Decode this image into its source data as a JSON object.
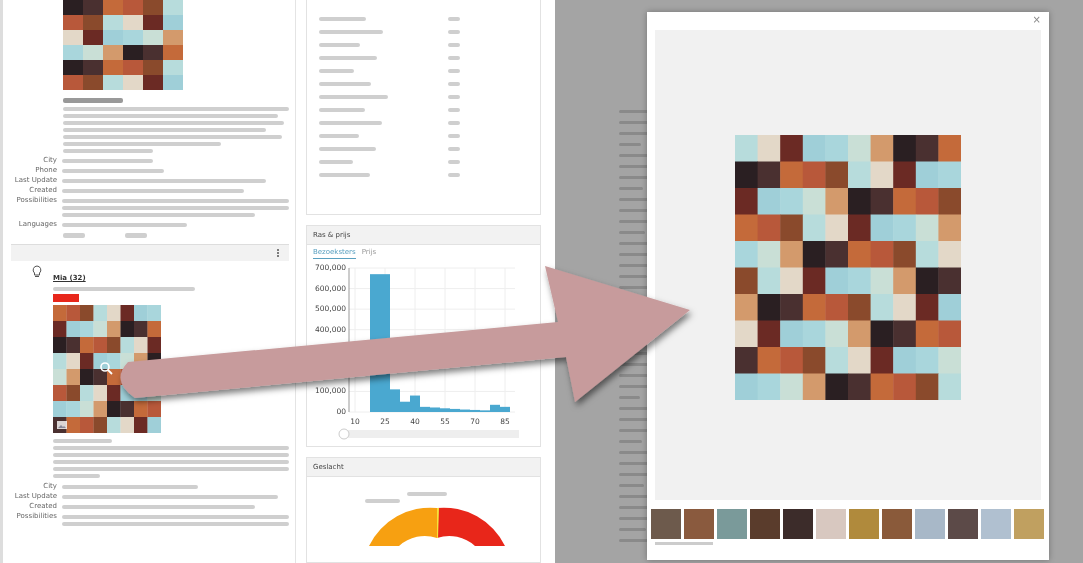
{
  "listing_top": {
    "fields": [
      {
        "label": "City"
      },
      {
        "label": "Phone"
      },
      {
        "label": "Last Update"
      },
      {
        "label": "Created"
      },
      {
        "label": "Possibilities"
      },
      {
        "label": "Languages"
      }
    ]
  },
  "listing_second": {
    "name": "Mia (32)",
    "fields": [
      {
        "label": "City"
      },
      {
        "label": "Last Update"
      },
      {
        "label": "Created"
      },
      {
        "label": "Possibilities"
      }
    ]
  },
  "price_card": {
    "title": "Ras & prijs",
    "tabs": [
      {
        "label": "Bezoeksters",
        "selected": true
      },
      {
        "label": "Prijs",
        "selected": false
      }
    ],
    "chart_data": {
      "type": "bar",
      "grid": true,
      "x": [
        20,
        25,
        30,
        35,
        40,
        45,
        50,
        55,
        60,
        65,
        70,
        75,
        80,
        85
      ],
      "values": [
        670000,
        670000,
        110000,
        50000,
        80000,
        25000,
        22000,
        18000,
        15000,
        12000,
        10000,
        8000,
        35000,
        25000
      ],
      "xlim": [
        7,
        90
      ],
      "ylim": [
        0,
        700000
      ],
      "xticks": [
        10,
        25,
        40,
        55,
        70,
        85
      ],
      "yticks": [
        {
          "value": 0,
          "label": "00"
        },
        {
          "value": 100000,
          "label": "100,000"
        },
        {
          "value": 400000,
          "label": "400,000"
        },
        {
          "value": 500000,
          "label": "500,000"
        },
        {
          "value": 600000,
          "label": "600,000"
        },
        {
          "value": 700000,
          "label": "700,000"
        }
      ]
    }
  },
  "gender_card": {
    "title": "Geslacht"
  },
  "lightbox": {
    "close": "×"
  }
}
